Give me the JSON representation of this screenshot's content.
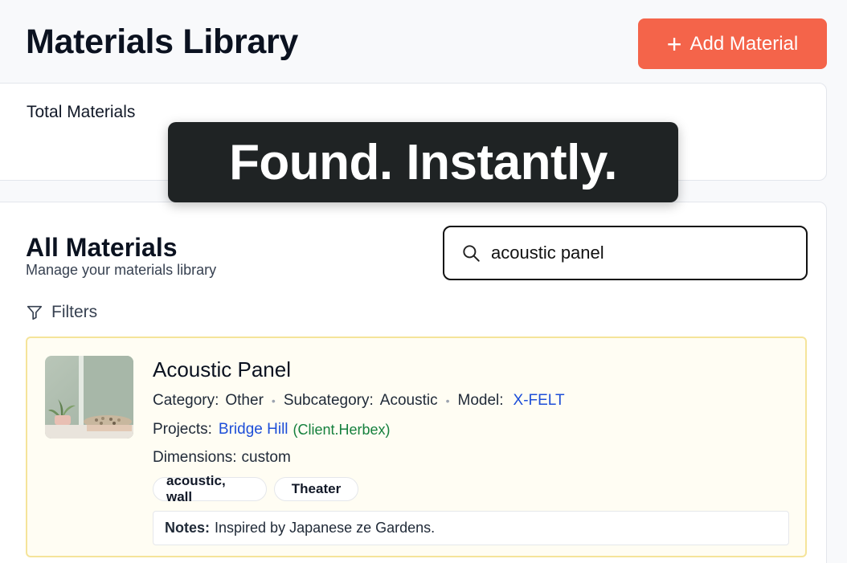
{
  "header": {
    "title": "Materials Library",
    "add_button_label": "Add Material",
    "add_button_icon": "plus-icon"
  },
  "stats": {
    "total_label": "Total Materials"
  },
  "overlay": {
    "text": "Found. Instantly."
  },
  "materials": {
    "title": "All Materials",
    "subtitle": "Manage your materials library",
    "search": {
      "icon": "search-icon",
      "value": "acoustic panel"
    },
    "filters_label": "Filters",
    "filters_icon": "filter-icon",
    "items": [
      {
        "name": "Acoustic Panel",
        "category_label": "Category:",
        "category": "Other",
        "subcategory_label": "Subcategory:",
        "subcategory": "Acoustic",
        "model_label": "Model:",
        "model": "X-FELT",
        "projects_label": "Projects:",
        "project": "Bridge Hill",
        "client": "(Client.Herbex)",
        "dimensions_label": "Dimensions:",
        "dimensions": "custom",
        "tags": [
          "acoustic, wall",
          "Theater"
        ],
        "notes_label": "Notes:",
        "notes": "Inspired by Japanese ze Gardens."
      }
    ]
  },
  "colors": {
    "accent": "#f4644a",
    "overlay_bg": "#1f2324",
    "highlight_bg": "#fffdf3",
    "highlight_border": "#f5e49a",
    "link": "#1d4ed8",
    "client": "#15803d"
  }
}
